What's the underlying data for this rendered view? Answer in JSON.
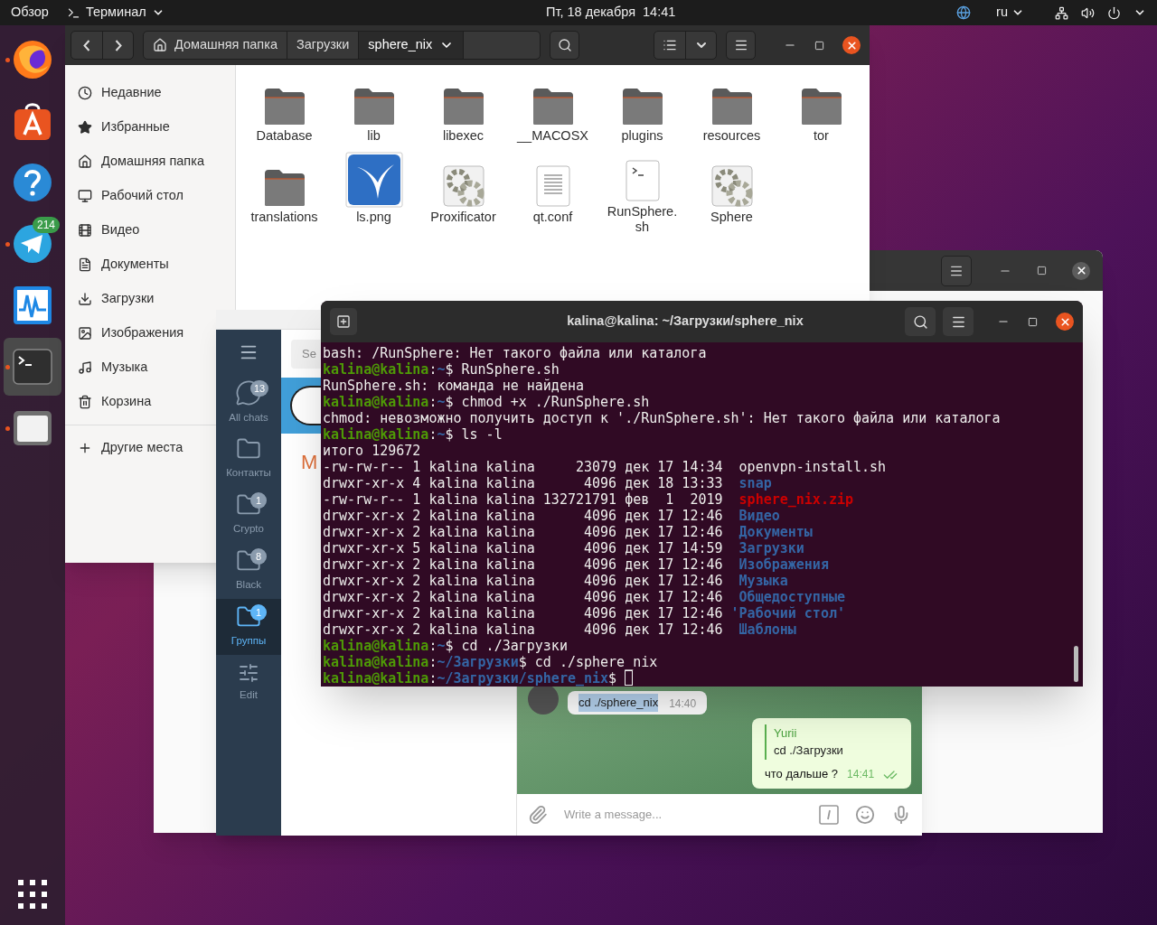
{
  "top_bar": {
    "activities": "Обзор",
    "app_menu": "Терминал",
    "clock": "Пт, 18 декабря  14:41",
    "keyboard_layout": "ru"
  },
  "dock": [
    {
      "kind": "firefox",
      "running": true,
      "selected": false
    },
    {
      "kind": "appstore",
      "running": false,
      "selected": false
    },
    {
      "kind": "help",
      "running": false,
      "selected": false
    },
    {
      "kind": "telegram",
      "running": true,
      "selected": false,
      "badge": "214"
    },
    {
      "kind": "monitor",
      "running": false,
      "selected": false
    },
    {
      "kind": "terminal",
      "running": true,
      "selected": true
    },
    {
      "kind": "files",
      "running": true,
      "selected": false
    }
  ],
  "files_window": {
    "crumbs": [
      {
        "label": "Домашняя папка",
        "kind": "home",
        "selected": false
      },
      {
        "label": "Загрузки",
        "kind": "folder",
        "selected": false
      },
      {
        "label": "sphere_nix",
        "kind": "folder",
        "selected": true
      }
    ],
    "sidebar": [
      {
        "label": "Недавние",
        "kind": "recent"
      },
      {
        "label": "Избранные",
        "kind": "starred"
      },
      {
        "label": "Домашняя папка",
        "kind": "home"
      },
      {
        "label": "Рабочий стол",
        "kind": "desktop"
      },
      {
        "label": "Видео",
        "kind": "video"
      },
      {
        "label": "Документы",
        "kind": "documents"
      },
      {
        "label": "Загрузки",
        "kind": "downloads"
      },
      {
        "label": "Изображения",
        "kind": "images"
      },
      {
        "label": "Музыка",
        "kind": "music"
      },
      {
        "label": "Корзина",
        "kind": "trash"
      },
      {
        "label": "Другие места",
        "kind": "other"
      }
    ],
    "items": [
      {
        "name": "Database",
        "kind": "folder"
      },
      {
        "name": "lib",
        "kind": "folder"
      },
      {
        "name": "libexec",
        "kind": "folder"
      },
      {
        "name": "__MACOSX",
        "kind": "folder"
      },
      {
        "name": "plugins",
        "kind": "folder"
      },
      {
        "name": "resources",
        "kind": "folder"
      },
      {
        "name": "tor",
        "kind": "folder"
      },
      {
        "name": "translations",
        "kind": "folder"
      },
      {
        "name": "ls.png",
        "kind": "image"
      },
      {
        "name": "Proxificator",
        "kind": "app"
      },
      {
        "name": "qt.conf",
        "kind": "text"
      },
      {
        "name": "RunSphere.sh",
        "kind": "script"
      },
      {
        "name": "Sphere",
        "kind": "app"
      }
    ]
  },
  "telegram": {
    "folders": [
      {
        "label": "All chats",
        "kind": "chats",
        "badge": "13",
        "selected": false
      },
      {
        "label": "Контакты",
        "kind": "folder",
        "selected": false
      },
      {
        "label": "Crypto",
        "kind": "folder",
        "badge": "1",
        "selected": false
      },
      {
        "label": "Black",
        "kind": "folder",
        "badge": "8",
        "selected": false
      },
      {
        "label": "Группы",
        "kind": "folder",
        "badge": "1",
        "selected": true
      },
      {
        "label": "Edit",
        "kind": "edit",
        "selected": false
      }
    ],
    "search": {
      "placeholder": "Se"
    },
    "chat_list_letter": "M",
    "messages": [
      {
        "outgoing": false,
        "text": "cd ./sphere_nix",
        "time": "14:40"
      },
      {
        "outgoing": true,
        "reply_author": "Yurii",
        "reply_text": "cd ./Загрузки",
        "text": "что дальше ?",
        "time": "14:41",
        "read": true
      }
    ],
    "input": {
      "placeholder": "Write a message..."
    }
  },
  "terminal": {
    "title": "kalina@kalina: ~/Загрузки/sphere_nix",
    "lines": [
      {
        "segments": [
          {
            "text": "bash: /RunSphere: Нет такого файла или каталога",
            "kind": "plain"
          }
        ]
      },
      {
        "segments": [
          {
            "text": "kalina@kalina",
            "kind": "user"
          },
          {
            "text": ":",
            "kind": "plain"
          },
          {
            "text": "~",
            "kind": "path"
          },
          {
            "text": "$ RunSphere.sh",
            "kind": "plain"
          }
        ]
      },
      {
        "segments": [
          {
            "text": "RunSphere.sh: команда не найдена",
            "kind": "plain"
          }
        ]
      },
      {
        "segments": [
          {
            "text": "kalina@kalina",
            "kind": "user"
          },
          {
            "text": ":",
            "kind": "plain"
          },
          {
            "text": "~",
            "kind": "path"
          },
          {
            "text": "$ chmod +x ./RunSphere.sh",
            "kind": "plain"
          }
        ]
      },
      {
        "segments": [
          {
            "text": "chmod: невозможно получить доступ к './RunSphere.sh': Нет такого файла или каталога",
            "kind": "plain"
          }
        ]
      },
      {
        "segments": [
          {
            "text": "kalina@kalina",
            "kind": "user"
          },
          {
            "text": ":",
            "kind": "plain"
          },
          {
            "text": "~",
            "kind": "path"
          },
          {
            "text": "$ ls -l",
            "kind": "plain"
          }
        ]
      },
      {
        "segments": [
          {
            "text": "итого 129672",
            "kind": "plain"
          }
        ]
      },
      {
        "segments": [
          {
            "text": "-rw-rw-r-- 1 kalina kalina     23079 дек 17 14:34  ",
            "kind": "plain"
          },
          {
            "text": "openvpn-install.sh",
            "kind": "plain"
          }
        ]
      },
      {
        "segments": [
          {
            "text": "drwxr-xr-x 4 kalina kalina      4096 дек 18 13:33  ",
            "kind": "plain"
          },
          {
            "text": "snap",
            "kind": "dir"
          }
        ]
      },
      {
        "segments": [
          {
            "text": "-rw-rw-r-- 1 kalina kalina 132721791 фев  1  2019  ",
            "kind": "plain"
          },
          {
            "text": "sphere_nix.zip",
            "kind": "archive"
          }
        ]
      },
      {
        "segments": [
          {
            "text": "drwxr-xr-x 2 kalina kalina      4096 дек 17 12:46  ",
            "kind": "plain"
          },
          {
            "text": "Видео",
            "kind": "dir"
          }
        ]
      },
      {
        "segments": [
          {
            "text": "drwxr-xr-x 2 kalina kalina      4096 дек 17 12:46  ",
            "kind": "plain"
          },
          {
            "text": "Документы",
            "kind": "dir"
          }
        ]
      },
      {
        "segments": [
          {
            "text": "drwxr-xr-x 5 kalina kalina      4096 дек 17 14:59  ",
            "kind": "plain"
          },
          {
            "text": "Загрузки",
            "kind": "dir"
          }
        ]
      },
      {
        "segments": [
          {
            "text": "drwxr-xr-x 2 kalina kalina      4096 дек 17 12:46  ",
            "kind": "plain"
          },
          {
            "text": "Изображения",
            "kind": "dir"
          }
        ]
      },
      {
        "segments": [
          {
            "text": "drwxr-xr-x 2 kalina kalina      4096 дек 17 12:46  ",
            "kind": "plain"
          },
          {
            "text": "Музыка",
            "kind": "dir"
          }
        ]
      },
      {
        "segments": [
          {
            "text": "drwxr-xr-x 2 kalina kalina      4096 дек 17 12:46  ",
            "kind": "plain"
          },
          {
            "text": "Общедоступные",
            "kind": "dir"
          }
        ]
      },
      {
        "segments": [
          {
            "text": "drwxr-xr-x 2 kalina kalina      4096 дек 17 12:46 ",
            "kind": "plain"
          },
          {
            "text": "'Рабочий стол'",
            "kind": "dir"
          }
        ]
      },
      {
        "segments": [
          {
            "text": "drwxr-xr-x 2 kalina kalina      4096 дек 17 12:46  ",
            "kind": "plain"
          },
          {
            "text": "Шаблоны",
            "kind": "dir"
          }
        ]
      },
      {
        "segments": [
          {
            "text": "kalina@kalina",
            "kind": "user"
          },
          {
            "text": ":",
            "kind": "plain"
          },
          {
            "text": "~",
            "kind": "path"
          },
          {
            "text": "$ cd ./Загрузки",
            "kind": "plain"
          }
        ]
      },
      {
        "segments": [
          {
            "text": "kalina@kalina",
            "kind": "user"
          },
          {
            "text": ":",
            "kind": "plain"
          },
          {
            "text": "~/Загрузки",
            "kind": "path"
          },
          {
            "text": "$ cd ./sphere_nix",
            "kind": "plain"
          }
        ]
      },
      {
        "segments": [
          {
            "text": "kalina@kalina",
            "kind": "user"
          },
          {
            "text": ":",
            "kind": "plain"
          },
          {
            "text": "~/Загрузки/sphere_nix",
            "kind": "path"
          },
          {
            "text": "$ ",
            "kind": "plain"
          }
        ],
        "cursor": true
      }
    ]
  }
}
